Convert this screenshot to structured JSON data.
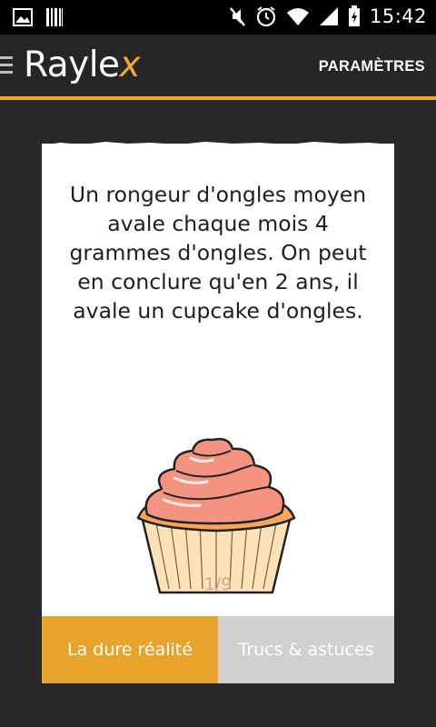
{
  "status_bar": {
    "time": "15:42",
    "icons": [
      "image-icon",
      "barcode-icon",
      "mute-icon",
      "alarm-icon",
      "wifi-icon",
      "signal-icon",
      "battery-icon"
    ]
  },
  "app_bar": {
    "logo_text": "Rayle",
    "logo_accent": "x",
    "settings_label": "PARAMÈTRES"
  },
  "card": {
    "fact_text": "Un rongeur d'ongles moyen avale chaque mois 4 grammes d'ongles. On peut en conclure qu'en 2 ans, il avale un cupcake d'ongles.",
    "illustration": "cupcake-icon",
    "page_indicator": "1/9"
  },
  "tabs": [
    {
      "label": "La dure réalité",
      "active": true
    },
    {
      "label": "Trucs & astuces",
      "active": false
    }
  ],
  "colors": {
    "accent": "#f0a827",
    "tab_active": "#e8a32a",
    "tab_inactive": "#d0d0d0",
    "background": "#282828",
    "frosting": "#f4937f",
    "cup": "#fde2b8"
  }
}
